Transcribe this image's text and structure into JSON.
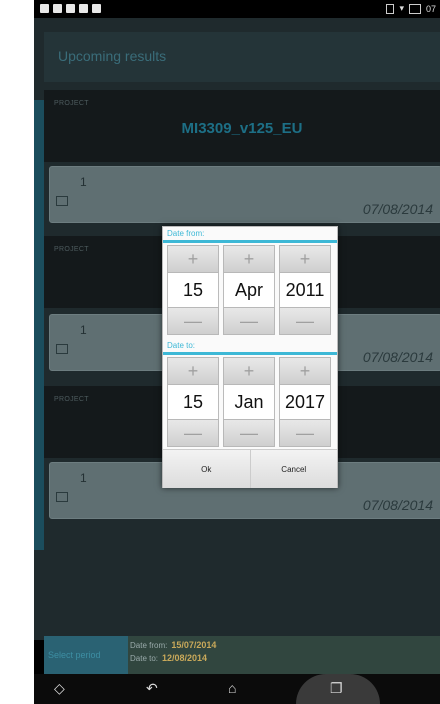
{
  "app": {
    "title": "Upcoming results",
    "project_label": "PROJECT",
    "project_name": "MI3309_v125_EU"
  },
  "cards": [
    {
      "num": "1",
      "date": "07/08/2014"
    },
    {
      "num": "1",
      "date": "07/08/2014"
    },
    {
      "num": "1",
      "date": "07/08/2014"
    }
  ],
  "dialog": {
    "from_label": "Date from:",
    "to_label": "Date to:",
    "from": {
      "day": "15",
      "month": "Apr",
      "year": "2011"
    },
    "to": {
      "day": "15",
      "month": "Jan",
      "year": "2017"
    },
    "ok_label": "Ok",
    "cancel_label": "Cancel",
    "plus": "+",
    "minus": "—"
  },
  "bottom": {
    "select_period": "Select period",
    "date_from_label": "Date from:",
    "date_from": "15/07/2014",
    "date_to_label": "Date to:",
    "date_to": "12/08/2014"
  },
  "icons": {
    "status_left": [
      "notification-icon",
      "notification-icon",
      "warning-icon",
      "notification-icon",
      "notification-icon"
    ],
    "status_right": [
      "vibrate-icon",
      "wifi-icon",
      "battery-icon"
    ],
    "status_time": "07",
    "nav": [
      "back-icon",
      "home-icon",
      "recents-icon"
    ]
  }
}
